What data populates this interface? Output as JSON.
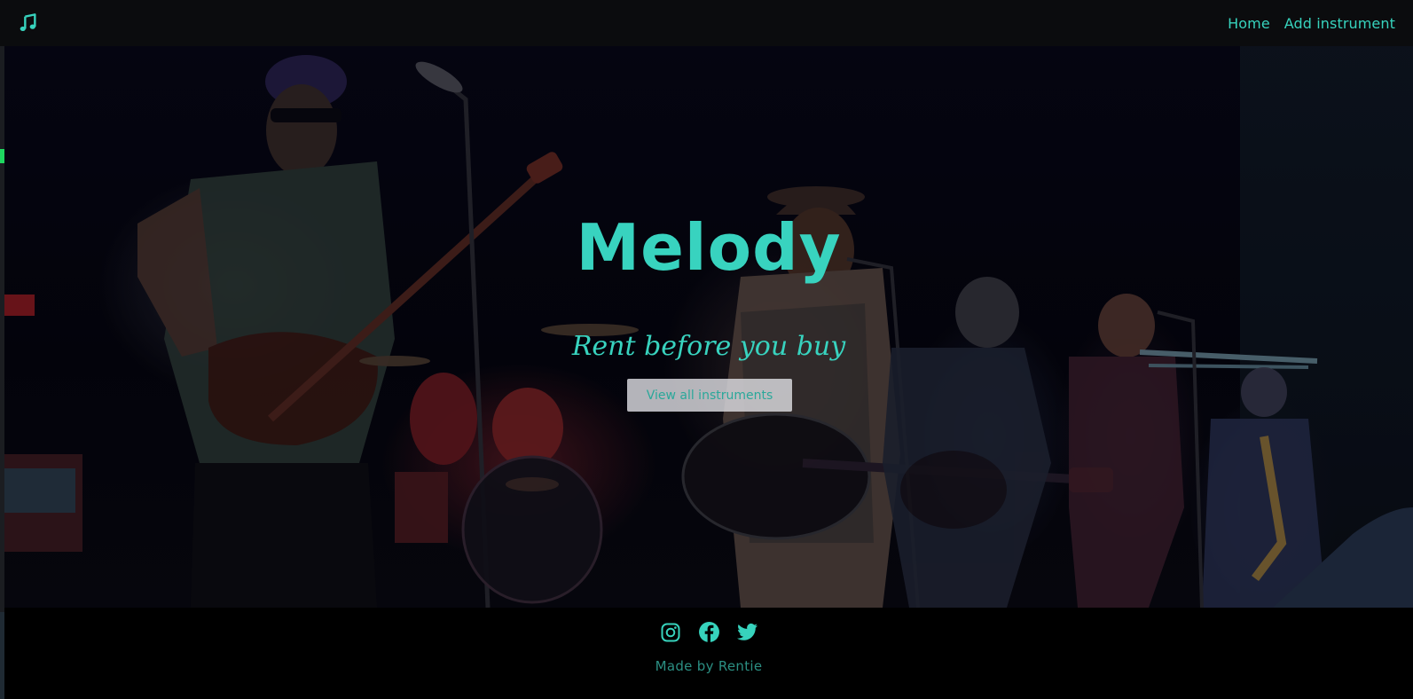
{
  "navbar": {
    "brand_icon": "music-note-icon",
    "links": [
      {
        "label": "Home"
      },
      {
        "label": "Add instrument"
      }
    ]
  },
  "hero": {
    "title": "Melody",
    "tagline": "Rent before you buy",
    "cta_label": "View all instruments",
    "background": "concert band photo"
  },
  "footer": {
    "social_icons": [
      "instagram-icon",
      "facebook-icon",
      "twitter-icon"
    ],
    "credit": "Made by Rentie"
  },
  "colors": {
    "accent": "#38d3bf",
    "navbar_bg": "#0b0c0e",
    "footer_bg": "#000000",
    "button_bg": "#dcdce0"
  }
}
